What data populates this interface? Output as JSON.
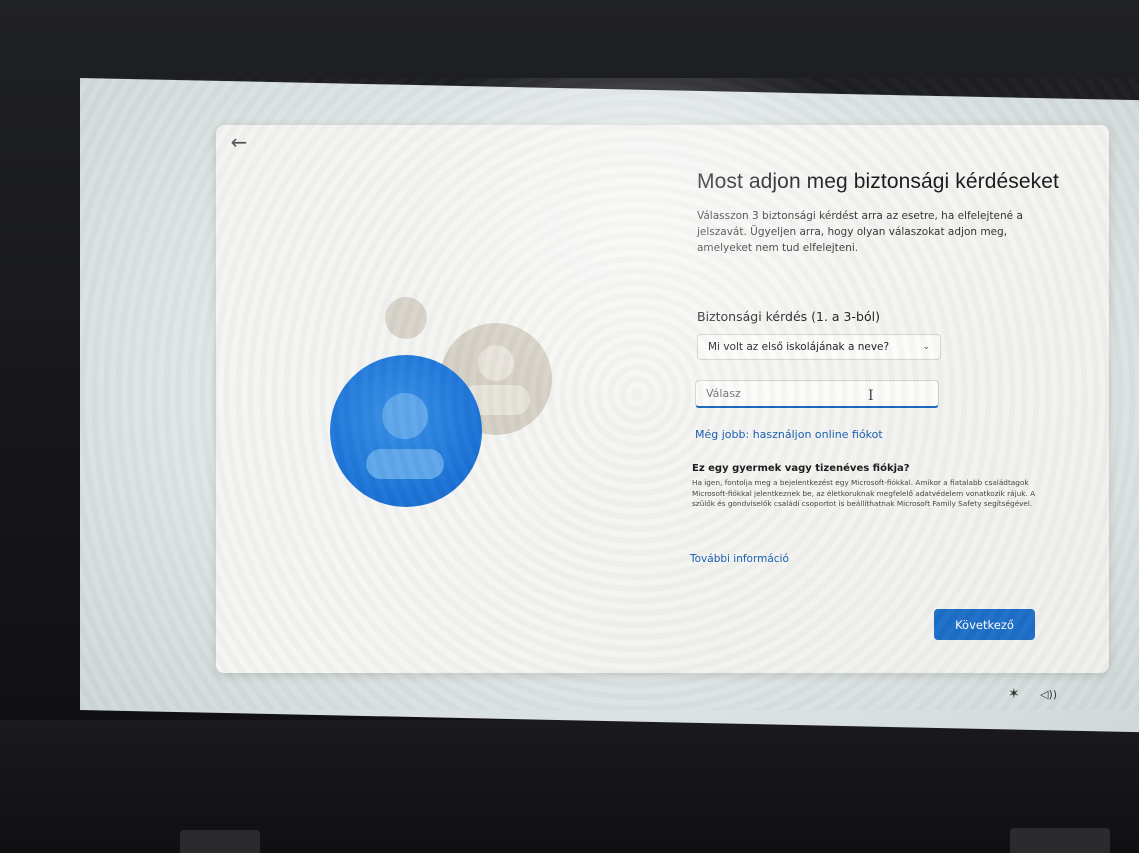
{
  "card": {
    "title": "Most adjon meg biztonsági kérdéseket",
    "description": "Válasszon 3 biztonsági kérdést arra az esetre, ha elfelejtené a jelszavát. Ügyeljen arra, hogy olyan válaszokat adjon meg, amelyeket nem tud elfelejteni."
  },
  "question": {
    "label": "Biztonsági kérdés (1. a 3-ból)",
    "selected": "Mi volt az első iskolájának a neve?"
  },
  "answer": {
    "placeholder": "Válasz",
    "value": ""
  },
  "links": {
    "online_account": "Még jobb: használjon online fiókot",
    "more_info": "További információ"
  },
  "child": {
    "heading": "Ez egy gyermek vagy tizenéves fiókja?",
    "text": "Ha igen, fontolja meg a bejelentkezést egy Microsoft-fiókkal. Amikor a fiatalabb családtagok Microsoft-fiókkal jelentkeznek be, az életkoruknak megfelelő adatvédelem vonatkozik rájuk. A szülők és gondviselők családi csoportot is beállíthatnak Microsoft Family Safety segítségével."
  },
  "buttons": {
    "next": "Következő"
  },
  "icons": {
    "back": "back-arrow-icon",
    "dropdown": "chevron-down-icon",
    "accessibility": "accessibility-icon",
    "volume": "volume-icon"
  },
  "colors": {
    "accent": "#1e6fc9",
    "link": "#1a5fb4",
    "illustration_blue": "#1d74d8"
  }
}
